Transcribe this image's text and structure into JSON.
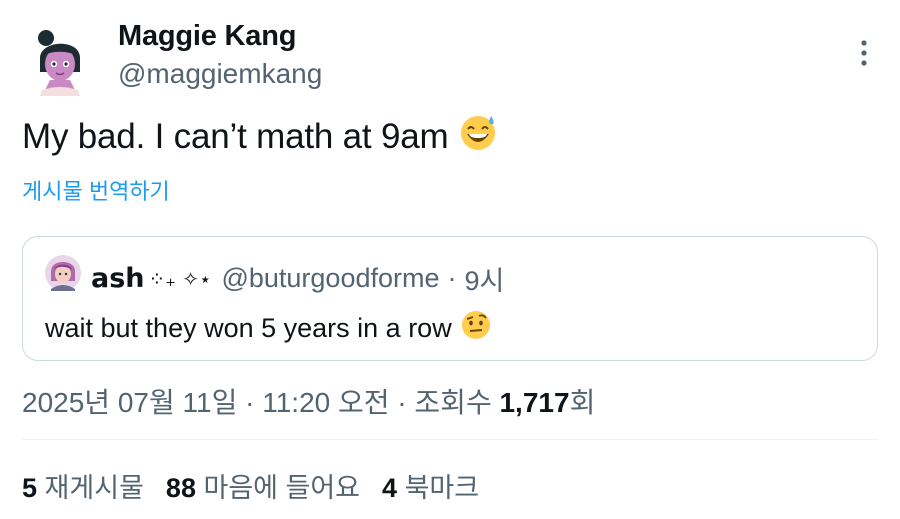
{
  "author": {
    "name": "Maggie Kang",
    "handle": "@maggiemkang"
  },
  "tweet": {
    "text": "My bad. I can’t math at 9am",
    "emoji": "sweat-smile-emoji"
  },
  "translate_label": "게시물 번역하기",
  "quoted": {
    "name": "ash",
    "name_symbols": "⁘₊ ✧⋆",
    "handle": "@buturgoodforme",
    "separator": "·",
    "time": "9시",
    "text": "wait but they won 5 years in a row",
    "emoji": "raised-eyebrow-emoji"
  },
  "meta": {
    "date": "2025년 07월 11일",
    "sep1": " · ",
    "time": "11:20 오전",
    "sep2": " · ",
    "views_label": "조회수 ",
    "views_count": "1,717",
    "views_suffix": "회"
  },
  "stats": {
    "reposts_count": "5",
    "reposts_label": "재게시물",
    "likes_count": "88",
    "likes_label": "마음에 들어요",
    "bookmarks_count": "4",
    "bookmarks_label": "북마크"
  },
  "colors": {
    "accent": "#1d9bf0",
    "secondary_text": "#536471",
    "primary_text": "#0f1419",
    "border": "#cfd9de"
  },
  "icons": [
    "more-vertical-icon"
  ]
}
